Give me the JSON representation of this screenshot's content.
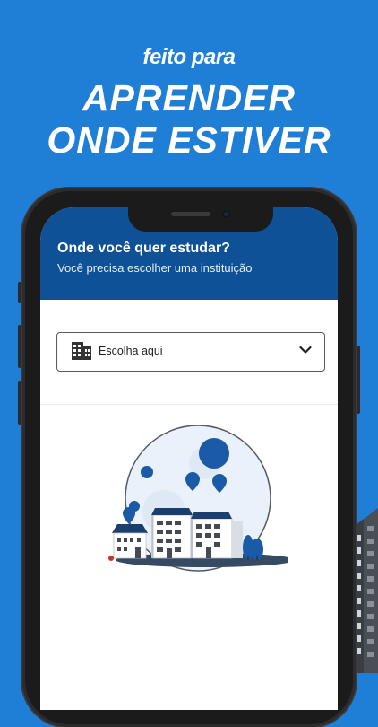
{
  "promo": {
    "tagline": "feito para",
    "headline_line1": "APRENDER",
    "headline_line2": "ONDE ESTIVER"
  },
  "header": {
    "title": "Onde você quer estudar?",
    "subtitle": "Você precisa escolher uma instituição"
  },
  "institution_select": {
    "value": "Escolha aqui",
    "icon": "building-icon",
    "dropdown_icon": "chevron-down-icon"
  },
  "colors": {
    "background": "#1f7fd6",
    "header": "#0f5196",
    "accent": "#1a5aa6"
  }
}
